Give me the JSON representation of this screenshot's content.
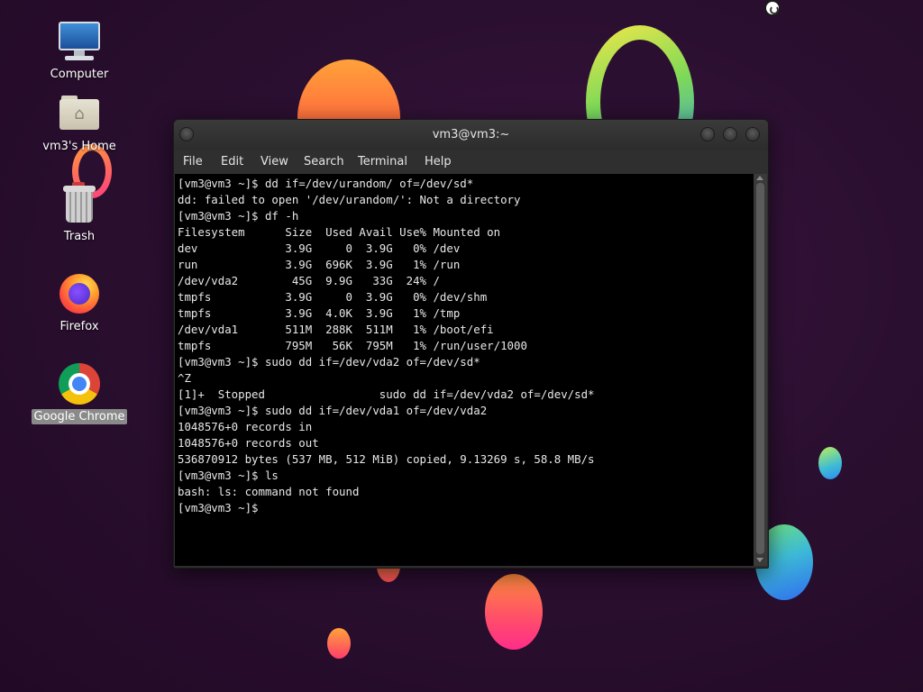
{
  "desktop": {
    "icons": [
      {
        "label": "Computer",
        "icon": "computer-icon"
      },
      {
        "label": "vm3's Home",
        "icon": "home-folder-icon"
      },
      {
        "label": "Trash",
        "icon": "trash-icon"
      },
      {
        "label": "Firefox",
        "icon": "firefox-icon"
      },
      {
        "label": "Google Chrome",
        "icon": "chrome-icon",
        "selected": true
      }
    ]
  },
  "terminal": {
    "title": "vm3@vm3:~",
    "menu": [
      "File",
      "Edit",
      "View",
      "Search",
      "Terminal",
      "Help"
    ],
    "lines": [
      "[vm3@vm3 ~]$ dd if=/dev/urandom/ of=/dev/sd*",
      "dd: failed to open '/dev/urandom/': Not a directory",
      "[vm3@vm3 ~]$ df -h",
      "Filesystem      Size  Used Avail Use% Mounted on",
      "dev             3.9G     0  3.9G   0% /dev",
      "run             3.9G  696K  3.9G   1% /run",
      "/dev/vda2        45G  9.9G   33G  24% /",
      "tmpfs           3.9G     0  3.9G   0% /dev/shm",
      "tmpfs           3.9G  4.0K  3.9G   1% /tmp",
      "/dev/vda1       511M  288K  511M   1% /boot/efi",
      "tmpfs           795M   56K  795M   1% /run/user/1000",
      "[vm3@vm3 ~]$ sudo dd if=/dev/vda2 of=/dev/sd*",
      "^Z",
      "[1]+  Stopped                 sudo dd if=/dev/vda2 of=/dev/sd*",
      "[vm3@vm3 ~]$ sudo dd if=/dev/vda1 of=/dev/vda2",
      "1048576+0 records in",
      "1048576+0 records out",
      "536870912 bytes (537 MB, 512 MiB) copied, 9.13269 s, 58.8 MB/s",
      "[vm3@vm3 ~]$ ls",
      "bash: ls: command not found",
      "[vm3@vm3 ~]$"
    ]
  },
  "colors": {
    "terminal_bg": "#000000",
    "terminal_fg": "#e8e8e8",
    "titlebar": "#2e2e2e",
    "selection": "#8a8a8a"
  }
}
